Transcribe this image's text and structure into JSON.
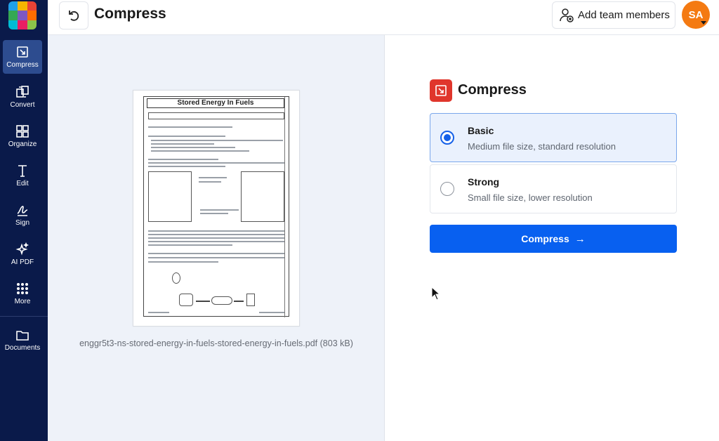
{
  "sidebar": {
    "logo_colors": [
      "#1fa0e9",
      "#f6b400",
      "#ea4335",
      "#34a853",
      "#7e57c2",
      "#ff6d00",
      "#00bcd4",
      "#e91e63",
      "#8bc34a"
    ],
    "items": [
      {
        "label": "Compress",
        "icon": "compress-icon",
        "active": true
      },
      {
        "label": "Convert",
        "icon": "convert-icon"
      },
      {
        "label": "Organize",
        "icon": "organize-icon"
      },
      {
        "label": "Edit",
        "icon": "edit-text-icon"
      },
      {
        "label": "Sign",
        "icon": "sign-icon"
      },
      {
        "label": "AI PDF",
        "icon": "sparkle-icon"
      },
      {
        "label": "More",
        "icon": "grid-dots-icon"
      },
      {
        "label": "Documents",
        "icon": "folder-icon"
      }
    ]
  },
  "header": {
    "title": "Compress",
    "add_team_label": "Add team members",
    "avatar_initials": "SA",
    "avatar_color": "#f47a12"
  },
  "preview": {
    "doc_title": "Stored Energy In Fuels",
    "file_name": "enggr5t3-ns-stored-energy-in-fuels-stored-energy-in-fuels.pdf (803 kB)"
  },
  "panel": {
    "title": "Compress",
    "options": [
      {
        "title": "Basic",
        "description": "Medium file size, standard resolution",
        "selected": true
      },
      {
        "title": "Strong",
        "description": "Small file size, lower resolution",
        "selected": false
      }
    ],
    "button_label": "Compress",
    "button_arrow": "→",
    "accent": "#0860f0"
  }
}
